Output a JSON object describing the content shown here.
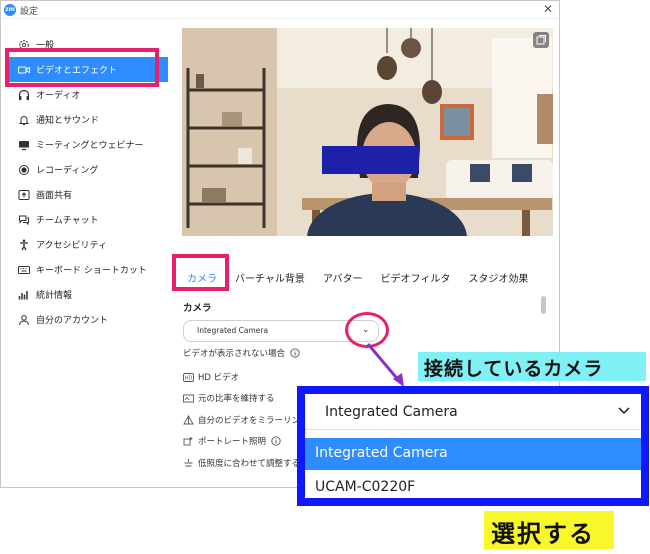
{
  "window": {
    "title": "設定",
    "app_icon": "zoom"
  },
  "sidebar": {
    "items": [
      {
        "label": "一般",
        "icon": "gear-icon"
      },
      {
        "label": "ビデオとエフェクト",
        "icon": "video-camera-icon",
        "active": true
      },
      {
        "label": "オーディオ",
        "icon": "headphones-icon"
      },
      {
        "label": "通知とサウンド",
        "icon": "bell-icon"
      },
      {
        "label": "ミーティングとウェビナー",
        "icon": "monitor-icon"
      },
      {
        "label": "レコーディング",
        "icon": "record-icon"
      },
      {
        "label": "画面共有",
        "icon": "share-screen-icon"
      },
      {
        "label": "チームチャット",
        "icon": "chat-icon"
      },
      {
        "label": "アクセシビリティ",
        "icon": "accessibility-icon"
      },
      {
        "label": "キーボード ショートカット",
        "icon": "keyboard-icon"
      },
      {
        "label": "統計情報",
        "icon": "stats-icon"
      },
      {
        "label": "自分のアカウント",
        "icon": "user-icon"
      }
    ]
  },
  "tabs": [
    {
      "label": "カメラ",
      "active": true
    },
    {
      "label": "バーチャル背景"
    },
    {
      "label": "アバター"
    },
    {
      "label": "ビデオフィルタ"
    },
    {
      "label": "スタジオ効果"
    }
  ],
  "camera": {
    "section_title": "カメラ",
    "selected": "Integrated Camera",
    "options": [
      {
        "label": "ビデオが表示されない場合",
        "icon": "info-icon"
      },
      {
        "label": "HD ビデオ",
        "icon": "hd-icon"
      },
      {
        "label": "元の比率を維持する",
        "icon": "ratio-icon"
      },
      {
        "label": "自分のビデオをミラーリングする",
        "icon": "mirror-icon"
      },
      {
        "label": "ポートレート照明",
        "icon": "portrait-light-icon"
      },
      {
        "label": "低照度に合わせて調整する",
        "icon": "low-light-icon"
      }
    ]
  },
  "annotation": {
    "connected_label": "接続しているカメラ",
    "select_label": "選択する",
    "dropdown_selected": "Integrated Camera",
    "dropdown_items": [
      "Integrated Camera",
      "UCAM-C0220F"
    ]
  },
  "colors": {
    "accent": "#2d8cff",
    "highlight": "#e6206f",
    "zoom_border": "#1018ff",
    "label_cyan": "#7ff0f4",
    "label_yellow": "#f7f72a"
  }
}
